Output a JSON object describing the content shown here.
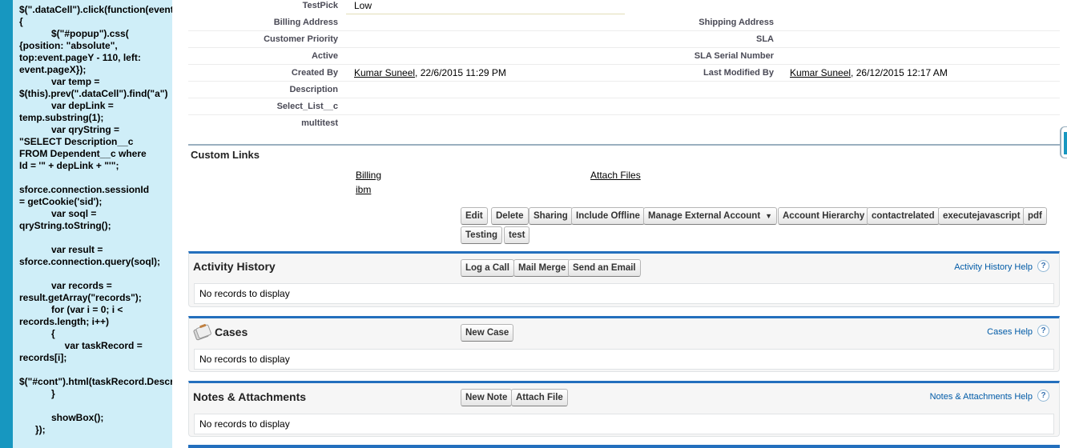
{
  "code_snippet": "$(\".dataCell\").click(function(event)\n{\n            $(\"#popup\").css(\n{position: \"absolute\",\ntop:event.pageY - 110, left:\nevent.pageX});\n            var temp =\n$(this).prev(\".dataCell\").find(\"a\")\n            var depLink =\ntemp.substring(1);\n            var qryString =\n\"SELECT Description__c\nFROM Dependent__c where\nId = '\" + depLink + \"'\";\n\nsforce.connection.sessionId\n= getCookie('sid');\n            var soql =\nqryString.toString();\n\n            var result =\nsforce.connection.query(soql);\n\n            var records =\nresult.getArray(\"records\");\n            for (var i = 0; i <\nrecords.length; i++)\n            {\n                 var taskRecord =\nrecords[i];\n\n$(\"#cont\").html(taskRecord.Description__c);\n            }\n\n            showBox();\n      });",
  "details": {
    "test_pick_label": "TestPick",
    "test_pick_value": "Low",
    "billing_address_label": "Billing Address",
    "shipping_address_label": "Shipping Address",
    "customer_priority_label": "Customer Priority",
    "sla_label": "SLA",
    "active_label": "Active",
    "sla_serial_label": "SLA Serial Number",
    "created_by_label": "Created By",
    "created_by_user": "Kumar Suneel",
    "created_by_date": ", 22/6/2015 11:29 PM",
    "last_modified_label": "Last Modified By",
    "last_modified_user": "Kumar Suneel",
    "last_modified_date": ", 26/12/2015 12:17 AM",
    "description_label": "Description",
    "select_list_label": "Select_List__c",
    "multitest_label": "multitest"
  },
  "custom_links": {
    "title": "Custom Links",
    "billing": "Billing",
    "attach_files": "Attach Files",
    "ibm": "ibm"
  },
  "buttons": {
    "edit": "Edit",
    "delete": "Delete",
    "sharing": "Sharing",
    "include_offline": "Include Offline",
    "manage_external": "Manage External Account",
    "account_hierarchy": "Account Hierarchy",
    "contactrelated": "contactrelated",
    "executejavascript": "executejavascript",
    "pdf": "pdf",
    "testing": "Testing",
    "test": "test"
  },
  "activity_history": {
    "title": "Activity History",
    "log_call": "Log a Call",
    "mail_merge": "Mail Merge",
    "send_email": "Send an Email",
    "help": "Activity History Help",
    "empty": "No records to display"
  },
  "cases": {
    "title": "Cases",
    "new_case": "New Case",
    "help": "Cases Help",
    "empty": "No records to display"
  },
  "notes": {
    "title": "Notes & Attachments",
    "new_note": "New Note",
    "attach_file": "Attach File",
    "help": "Notes & Attachments Help",
    "empty": "No records to display"
  },
  "help_glyph": "?",
  "colors": {
    "sidebar_bg": "#cfeef8",
    "edge_blue": "#1797c0",
    "section_accent": "#236fbd",
    "help_link": "#015ba7"
  }
}
